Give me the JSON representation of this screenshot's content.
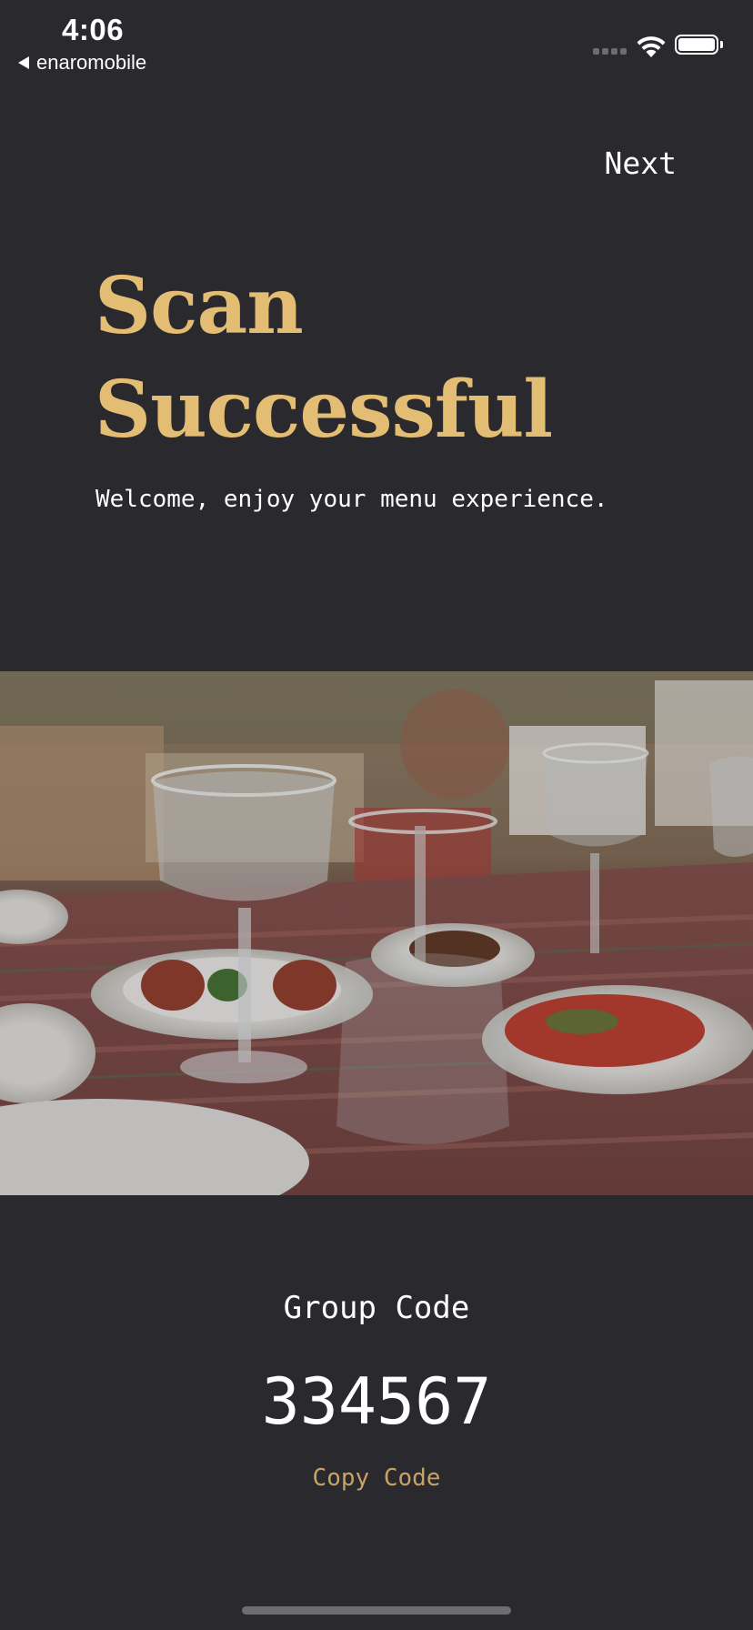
{
  "status_bar": {
    "time": "4:06",
    "back_app": "enaromobile"
  },
  "header": {
    "next_label": "Next"
  },
  "hero": {
    "title_line1": "Scan",
    "title_line2": "Successful",
    "subtitle": "Welcome, enjoy your menu experience."
  },
  "group": {
    "label": "Group Code",
    "code": "334567",
    "copy_label": "Copy Code"
  },
  "colors": {
    "background": "#2a292e",
    "accent": "#e3bd74",
    "copy_accent": "#c7a266"
  },
  "icons": [
    "back-arrow-icon",
    "cellular-signal-icon",
    "wifi-icon",
    "battery-icon"
  ]
}
